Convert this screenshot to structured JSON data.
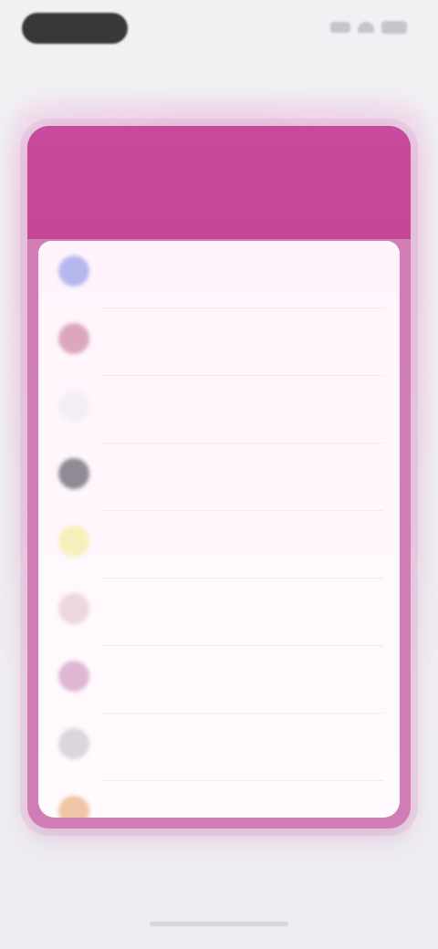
{
  "status_bar": {
    "icons": [
      "signal-icon",
      "wifi-icon",
      "battery-icon"
    ]
  },
  "top_caption": "",
  "card": {
    "header_title": "",
    "header_subtitle": ""
  },
  "list": {
    "items": [
      {
        "label": "",
        "icon": "blue-circle-icon",
        "color": "#b7b7ef"
      },
      {
        "label": "",
        "icon": "rose-circle-icon",
        "color": "#dca7bd"
      },
      {
        "label": "",
        "icon": "light-circle-icon",
        "color": "#f2eef5"
      },
      {
        "label": "",
        "icon": "gray-circle-icon",
        "color": "#8f8a93"
      },
      {
        "label": "",
        "icon": "yellow-circle-icon",
        "color": "#f7f0ba"
      },
      {
        "label": "",
        "icon": "pink-circle-icon",
        "color": "#ecd7df"
      },
      {
        "label": "",
        "icon": "mauve-circle-icon",
        "color": "#deb7d4"
      },
      {
        "label": "",
        "icon": "gray-circle-icon",
        "color": "#d9d6dc"
      },
      {
        "label": "",
        "icon": "amber-circle-icon",
        "color": "#efc5a5"
      }
    ]
  },
  "bottom_caption": "",
  "colors": {
    "accent": "#c84a9c",
    "panel": "#fff8fc",
    "background": "#eeedf1"
  }
}
